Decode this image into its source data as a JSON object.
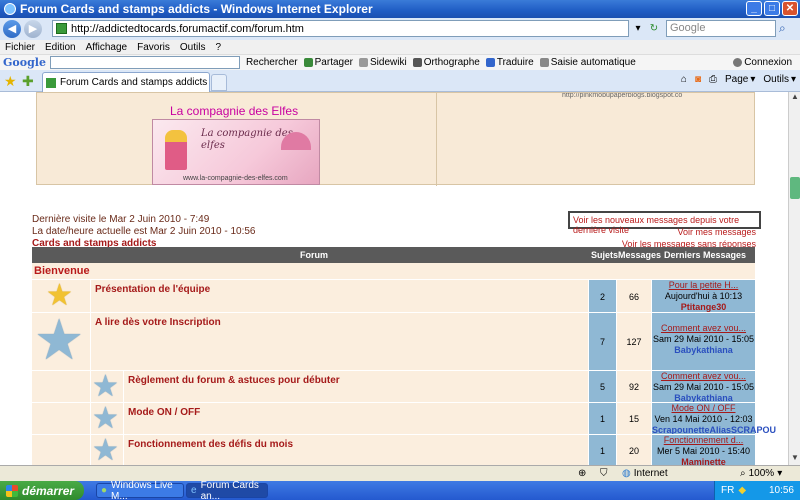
{
  "window": {
    "title": "Forum Cards and stamps addicts - Windows Internet Explorer",
    "controls": [
      "_",
      "□",
      "✕"
    ]
  },
  "addressbar": {
    "url": "http://addictedtocards.forumactif.com/forum.htm",
    "search_placeholder": "Google"
  },
  "menubar": {
    "items": [
      "Fichier",
      "Edition",
      "Affichage",
      "Favoris",
      "Outils",
      "?"
    ]
  },
  "google_toolbar": {
    "logo": "Google",
    "items": [
      "Rechercher",
      "Partager",
      "Sidewiki",
      "Orthographe",
      "Traduire",
      "Saisie automatique",
      "Connexion"
    ]
  },
  "tabbar": {
    "active_tab": "Forum Cards and stamps addicts",
    "commands": [
      "Page",
      "Outils"
    ]
  },
  "banner": {
    "title": "La compagnie des Elfes",
    "image_text": "La compagnie des elfes",
    "image_url": "www.la-compagnie-des-elfes.com",
    "right_url": "http://pinkmobupaperblogs.blogspot.com"
  },
  "visit": {
    "last_visit": "Dernière visite le Mar 2 Juin 2010 - 7:49",
    "current_time": "La date/heure actuelle est Mar 2 Juin 2010 - 10:56",
    "category_link": "Cards and stamps addicts"
  },
  "links": {
    "new_messages": "Voir les nouveaux messages depuis votre dernière visite",
    "my_messages": "Voir mes messages",
    "unanswered": "Voir les messages sans réponses"
  },
  "table": {
    "headers": {
      "forum": "Forum",
      "topics": "Sujets",
      "messages": "Messages",
      "last_messages": "Derniers Messages"
    },
    "category": "Bienvenue",
    "rows": [
      {
        "title": "Présentation de l'équipe",
        "topics": "2",
        "messages": "66",
        "last_title": "Pour la petite H...",
        "last_date": "Aujourd'hui à 10:13",
        "last_user": "Ptitange30"
      },
      {
        "title": "A lire dès votre Inscription",
        "topics": "7",
        "messages": "127",
        "last_title": "Comment avez vou...",
        "last_date": "Sam 29 Mai 2010 - 15:05",
        "last_user": "Babykathiana"
      },
      {
        "title": "Règlement du forum & astuces pour débuter",
        "topics": "5",
        "messages": "92",
        "last_title": "Comment avez vou...",
        "last_date": "Sam 29 Mai 2010 - 15:05",
        "last_user": "Babykathiana"
      },
      {
        "title": "Mode ON / OFF",
        "topics": "1",
        "messages": "15",
        "last_title": "Mode ON / OFF",
        "last_date": "Ven 14 Mai 2010 - 12:03",
        "last_user": "ScrapounetteAliasSCRAPOU"
      },
      {
        "title": "Fonctionnement des défis du mois",
        "topics": "1",
        "messages": "20",
        "last_title": "Fonctionnement d...",
        "last_date": "Mer 5 Mai 2010 - 15:40",
        "last_user": "Maminette"
      }
    ]
  },
  "statusbar": {
    "zone": "Internet",
    "zoom": "100%"
  },
  "taskbar": {
    "start": "démarrer",
    "items": [
      "Windows Live M...",
      "Forum Cards an..."
    ],
    "lang": "FR",
    "clock": "10:56"
  },
  "colors": {
    "forum_title": "#a51a1a",
    "row_bg": "#fbeede",
    "stat_bg": "#8fb8d4",
    "header_bg": "#5a5a5a"
  }
}
